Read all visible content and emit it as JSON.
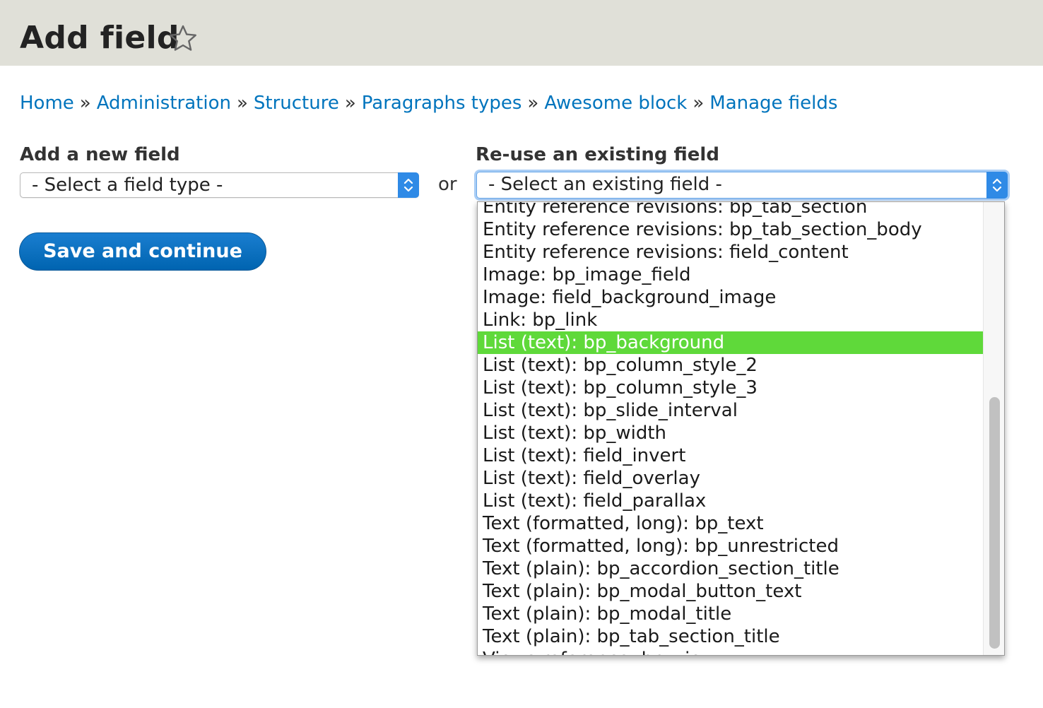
{
  "page": {
    "title": "Add field"
  },
  "breadcrumb": [
    {
      "label": "Home"
    },
    {
      "label": "Administration"
    },
    {
      "label": "Structure"
    },
    {
      "label": "Paragraphs types"
    },
    {
      "label": "Awesome block"
    },
    {
      "label": "Manage fields"
    }
  ],
  "breadcrumb_separator": "»",
  "add_new": {
    "label": "Add a new field",
    "selected": "- Select a field type -"
  },
  "or_text": "or",
  "reuse": {
    "label": "Re-use an existing field",
    "selected": "- Select an existing field -",
    "options": [
      "Entity reference revisions: bp_tab_section",
      "Entity reference revisions: bp_tab_section_body",
      "Entity reference revisions: field_content",
      "Image: bp_image_field",
      "Image: field_background_image",
      "Link: bp_link",
      "List (text): bp_background",
      "List (text): bp_column_style_2",
      "List (text): bp_column_style_3",
      "List (text): bp_slide_interval",
      "List (text): bp_width",
      "List (text): field_invert",
      "List (text): field_overlay",
      "List (text): field_parallax",
      "Text (formatted, long): bp_text",
      "Text (formatted, long): bp_unrestricted",
      "Text (plain): bp_accordion_section_title",
      "Text (plain): bp_modal_button_text",
      "Text (plain): bp_modal_title",
      "Text (plain): bp_tab_section_title",
      "Views reference: bp_view"
    ],
    "highlighted": "List (text): bp_background"
  },
  "save_button": {
    "label": "Save and continue"
  },
  "colors": {
    "link": "#0074bd",
    "header_bg": "#e0e0d8",
    "highlight": "#5fd93a",
    "button": "#0071c1"
  }
}
